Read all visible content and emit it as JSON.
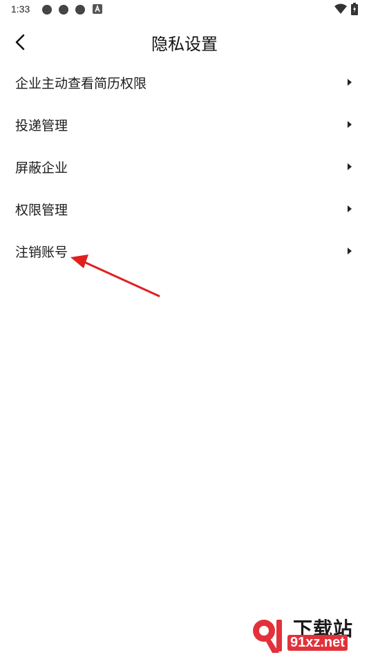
{
  "status_bar": {
    "time": "1:33",
    "icons": [
      "app-notification-icon",
      "app-notification-icon",
      "app-notification-icon",
      "a-badge-icon",
      "wifi-icon",
      "battery-icon"
    ]
  },
  "header": {
    "title": "隐私设置",
    "back_icon": "chevron-left-icon"
  },
  "menu": {
    "items": [
      {
        "label": "企业主动查看简历权限"
      },
      {
        "label": "投递管理"
      },
      {
        "label": "屏蔽企业"
      },
      {
        "label": "权限管理"
      },
      {
        "label": "注销账号"
      }
    ],
    "arrow_icon": "triangle-right-icon"
  },
  "watermark": {
    "logo_text": "下载站",
    "url": "91xz.net",
    "accent": "#e3313a"
  },
  "annotation": {
    "color": "#e02020"
  }
}
